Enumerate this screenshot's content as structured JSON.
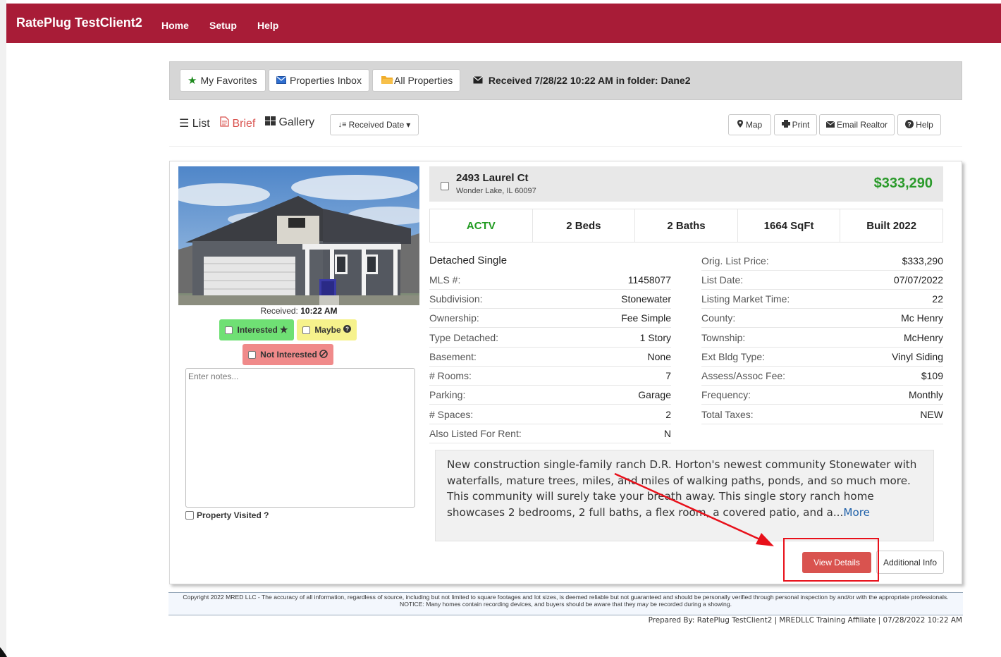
{
  "navbar": {
    "brand": "RatePlug TestClient2",
    "links": [
      "Home",
      "Setup",
      "Help"
    ]
  },
  "folderbar": {
    "favorites": "My Favorites",
    "inbox": "Properties Inbox",
    "all": "All Properties",
    "received": "Received 7/28/22 10:22 AM in folder: Dane2"
  },
  "view": {
    "list": "List",
    "brief": "Brief",
    "gallery": "Gallery",
    "sort": "Received Date",
    "map": "Map",
    "print": "Print",
    "email": "Email Realtor",
    "help": "Help"
  },
  "listing": {
    "received_label": "Received:",
    "received_time": "10:22 AM",
    "interested": "Interested",
    "maybe": "Maybe",
    "not_interested": "Not Interested",
    "notes_placeholder": "Enter notes...",
    "visited": "Property Visited ?",
    "address": "2493 Laurel Ct",
    "city": "Wonder Lake, IL 60097",
    "price": "$333,290",
    "status": "ACTV",
    "beds": "2 Beds",
    "baths": "2 Baths",
    "sqft": "1664 SqFt",
    "built": "Built 2022",
    "type": "Detached Single",
    "left_details": [
      {
        "label": "MLS #:",
        "value": "11458077"
      },
      {
        "label": "Subdivision:",
        "value": "Stonewater"
      },
      {
        "label": "Ownership:",
        "value": "Fee Simple"
      },
      {
        "label": "Type Detached:",
        "value": "1 Story"
      },
      {
        "label": "Basement:",
        "value": "None"
      },
      {
        "label": "# Rooms:",
        "value": "7"
      },
      {
        "label": "Parking:",
        "value": "Garage"
      },
      {
        "label": "# Spaces:",
        "value": "2"
      },
      {
        "label": "Also Listed For Rent:",
        "value": "N"
      }
    ],
    "right_details": [
      {
        "label": "Orig. List Price:",
        "value": "$333,290"
      },
      {
        "label": "List Date:",
        "value": "07/07/2022"
      },
      {
        "label": "Listing Market Time:",
        "value": "22"
      },
      {
        "label": "County:",
        "value": "Mc Henry"
      },
      {
        "label": "Township:",
        "value": "McHenry"
      },
      {
        "label": "Ext Bldg Type:",
        "value": "Vinyl Siding"
      },
      {
        "label": "Assess/Assoc Fee:",
        "value": "$109"
      },
      {
        "label": "Frequency:",
        "value": "Monthly"
      },
      {
        "label": "Total Taxes:",
        "value": "NEW"
      }
    ],
    "description": "New construction single-family ranch D.R. Horton's newest community Stonewater with waterfalls, mature trees, miles, and miles of walking paths, ponds, and so much more. This community will surely take your breath away. This single story ranch home showcases 2 bedrooms, 2 full baths, a flex room, a covered patio, and a...",
    "more": "More",
    "view_details": "View Details",
    "additional_info": "Additional Info"
  },
  "footer": {
    "copyright": "Copyright 2022 MRED LLC - The accuracy of all information, regardless of source, including but not limited to square footages and lot sizes, is deemed reliable but not guaranteed and should be personally verified through personal inspection by and/or with the appropriate professionals.",
    "notice": "NOTICE: Many homes contain recording devices, and buyers should be aware that they may be recorded during a showing.",
    "prepared": "Prepared By: RatePlug TestClient2 | MREDLLC Training Affiliate | 07/28/2022 10:22 AM"
  },
  "colors": {
    "navbar": "#a81c37",
    "price": "#2a9a2a",
    "status": "#1f9a1f",
    "view_details": "#d9534f",
    "annotation": "#e8101a"
  }
}
